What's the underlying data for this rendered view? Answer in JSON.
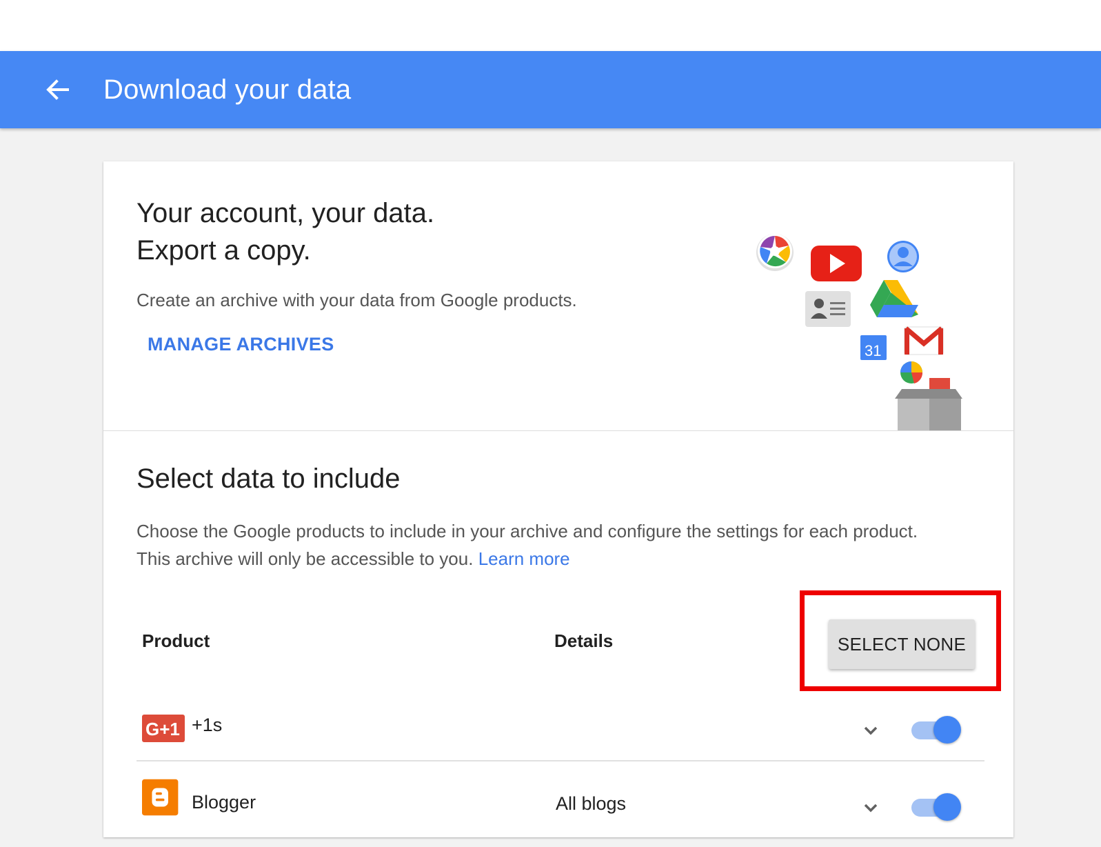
{
  "appbar": {
    "title": "Download your data",
    "back_icon": "arrow-back-icon",
    "color": "#4688f4"
  },
  "hero": {
    "title_line1": "Your account, your data.",
    "title_line2": "Export a copy.",
    "subtitle": "Create an archive with your data from Google products.",
    "manage_label": "MANAGE ARCHIVES",
    "illustration_icons": [
      "picasa-icon",
      "youtube-icon",
      "contacts-icon",
      "drive-icon",
      "profile-icon",
      "calendar-icon",
      "gmail-icon",
      "hangouts-icon",
      "archive-box-icon"
    ]
  },
  "section": {
    "title": "Select data to include",
    "description_line1": "Choose the Google products to include in your archive and configure the settings for each product.",
    "description_line2": "This archive will only be accessible to you.",
    "learn_more": "Learn more"
  },
  "table": {
    "col_product": "Product",
    "col_details": "Details",
    "select_none_label": "SELECT NONE",
    "rows": [
      {
        "icon": "google-plus-one-icon",
        "icon_text": "G+1",
        "name": "+1s",
        "details": "",
        "enabled": true
      },
      {
        "icon": "blogger-icon",
        "icon_text": "B",
        "name": "Blogger",
        "details": "All blogs",
        "enabled": true
      }
    ]
  },
  "colors": {
    "accent": "#3b78e7",
    "toggle_on": "#4285f4",
    "highlight": "#ee0000"
  }
}
